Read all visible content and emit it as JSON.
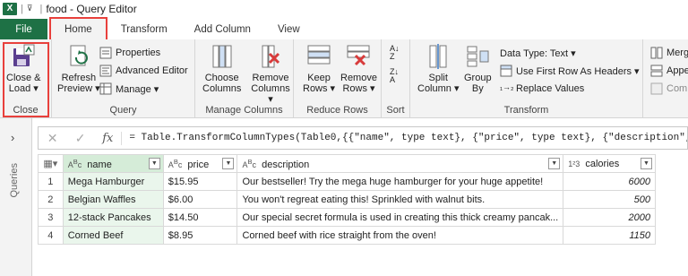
{
  "titlebar": {
    "app_letter": "X",
    "title": "food - Query Editor"
  },
  "tabs": [
    "File",
    "Home",
    "Transform",
    "Add Column",
    "View"
  ],
  "ribbon": {
    "close": {
      "label1": "Close &",
      "label2": "Load ▾",
      "group": "Close"
    },
    "query": {
      "refresh1": "Refresh",
      "refresh2": "Preview ▾",
      "properties": "Properties",
      "advanced": "Advanced Editor",
      "manage": "Manage ▾",
      "group": "Query"
    },
    "manage_columns": {
      "choose1": "Choose",
      "choose2": "Columns",
      "remove1": "Remove",
      "remove2": "Columns ▾",
      "group": "Manage Columns"
    },
    "reduce_rows": {
      "keep1": "Keep",
      "keep2": "Rows ▾",
      "remove1": "Remove",
      "remove2": "Rows ▾",
      "group": "Reduce Rows"
    },
    "sort": {
      "group": "Sort"
    },
    "transform": {
      "split1": "Split",
      "split2": "Column ▾",
      "group1": "Group",
      "group2": "By",
      "datatype": "Data Type: Text ▾",
      "first_row": "Use First Row As Headers ▾",
      "replace": "Replace Values",
      "group": "Transform"
    },
    "combine": {
      "merge": "Merg",
      "append": "Appe",
      "combine": "Com"
    }
  },
  "leftpane": {
    "label": "Queries"
  },
  "formula": "= Table.TransformColumnTypes(Table0,{{\"name\", type text}, {\"price\", type text}, {\"description\", t",
  "table": {
    "columns": [
      {
        "type": "ABC",
        "name": "name"
      },
      {
        "type": "ABC",
        "name": "price"
      },
      {
        "type": "ABC",
        "name": "description"
      },
      {
        "type": "123",
        "name": "calories"
      }
    ],
    "rows": [
      {
        "n": "1",
        "name": "Mega Hamburger",
        "price": "$15.95",
        "description": "Our bestseller! Try the mega huge hamburger for your huge appetite!",
        "calories": "6000"
      },
      {
        "n": "2",
        "name": "Belgian Waffles",
        "price": "$6.00",
        "description": "You won't regreat eating this! Sprinkled with walnut bits.",
        "calories": "500"
      },
      {
        "n": "3",
        "name": "12-stack Pancakes",
        "price": "$14.50",
        "description": "Our special secret formula is used in creating this thick creamy pancak...",
        "calories": "2000"
      },
      {
        "n": "4",
        "name": "Corned Beef",
        "price": "$8.95",
        "description": "Corned beef with rice straight from the oven!",
        "calories": "1150"
      }
    ]
  },
  "colors": {
    "excel_green": "#1e7145",
    "highlight_red": "#e8403c",
    "name_col": "#d5ecd8"
  }
}
